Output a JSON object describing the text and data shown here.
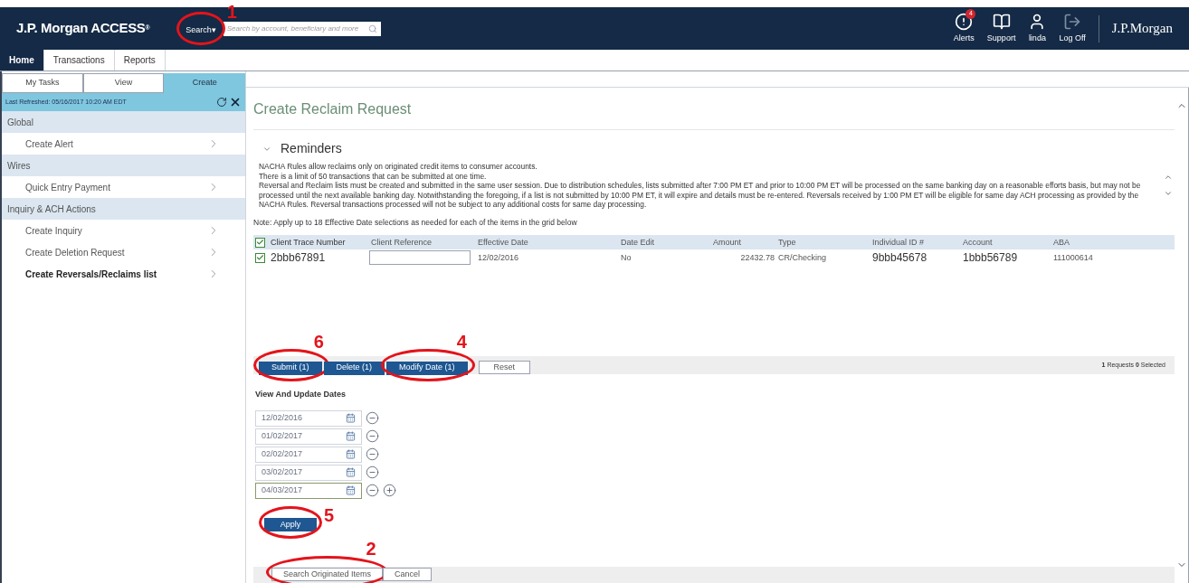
{
  "header": {
    "brand": "J.P. Morgan ACCESS",
    "brand_mark": "®",
    "search_button": {
      "label": "Search▾",
      "callout": "1"
    },
    "search_field": {
      "placeholder": "Search by account, beneficiary and more"
    },
    "actions": [
      {
        "kind": "alert",
        "label": "Alerts",
        "badge": "4"
      },
      {
        "kind": "support",
        "label": "Support"
      },
      {
        "kind": "user",
        "label": "linda"
      },
      {
        "kind": "logoff",
        "label": "Log Off"
      }
    ],
    "logo": "J.P.Morgan"
  },
  "tabs": [
    {
      "label": "Home",
      "selected": true
    },
    {
      "label": "Transactions",
      "selected": false
    },
    {
      "label": "Reports",
      "selected": false
    }
  ],
  "sidebar": {
    "tabs": [
      {
        "label": "My Tasks",
        "selected": false
      },
      {
        "label": "View",
        "selected": false
      },
      {
        "label": "Create",
        "selected": true
      }
    ],
    "last_refreshed": "Last Refreshed: 05/16/2017 10:20 AM EDT",
    "items": [
      {
        "kind": "group",
        "label": "Global"
      },
      {
        "kind": "link",
        "label": "Create Alert",
        "active": false
      },
      {
        "kind": "group",
        "label": "Wires"
      },
      {
        "kind": "link",
        "label": "Quick Entry Payment",
        "active": false
      },
      {
        "kind": "group",
        "label": "Inquiry & ACH Actions"
      },
      {
        "kind": "link",
        "label": "Create Inquiry",
        "active": false
      },
      {
        "kind": "link",
        "label": "Create Deletion Request",
        "active": false
      },
      {
        "kind": "link",
        "label": "Create Reversals/Reclaims list",
        "active": true
      }
    ]
  },
  "main": {
    "title": "Create Reclaim Request",
    "reminders": {
      "title": "Reminders",
      "expanded": true,
      "lines": [
        "NACHA Rules allow reclaims only on originated credit items to consumer accounts.",
        "There is a limit of 50 transactions that can be submitted at one time.",
        "Reversal and Reclaim lists must be created and submitted in the same user session. Due to distribution schedules, lists submitted after 7:00 PM ET and prior to 10:00 PM ET will be processed on the same banking day on a reasonable efforts basis, but may not be processed until the next available banking day. Notwithstanding the foregoing, if a list is not submitted by 10:00 PM ET, it will expire and details must be re-entered. Reversals received by 1:00 PM ET will be eligible for same day ACH processing as provided by the NACHA Rules. Reversal transactions processed will not be subject to any additional costs for same day processing."
      ]
    },
    "note": "Note: Apply up to 18 Effective Date selections as needed for each of the items in the grid below",
    "table": {
      "all_checked": true,
      "columns": [
        "Client Trace Number",
        "Client Reference",
        "Effective Date",
        "Date Edit",
        "Amount",
        "Type",
        "Individual ID #",
        "Account",
        "ABA"
      ],
      "rows": [
        {
          "checked": true,
          "cells": [
            "2bbb67891",
            "",
            "12/02/2016",
            "No",
            "22432.78",
            "CR/Checking",
            "9bbb45678",
            "1bbb56789",
            "111000614"
          ]
        }
      ]
    },
    "actions": [
      {
        "kind": "primary",
        "label": "Submit (1)",
        "callout": "6"
      },
      {
        "kind": "primary",
        "label": "Delete (1)"
      },
      {
        "kind": "primary",
        "label": "Modify Date (1)",
        "callout": "4"
      },
      {
        "kind": "secondary",
        "label": "Reset"
      }
    ],
    "summary": "**1** Requests  **0** Selected",
    "dates": {
      "title": "View And Update Dates",
      "fields": [
        {
          "value": "12/02/2016",
          "focused": false,
          "addable": false
        },
        {
          "value": "01/02/2017",
          "focused": false,
          "addable": false
        },
        {
          "value": "02/02/2017",
          "focused": false,
          "addable": false
        },
        {
          "value": "03/02/2017",
          "focused": false,
          "addable": false
        },
        {
          "value": "04/03/2017",
          "focused": true,
          "addable": true
        }
      ],
      "apply": {
        "label": "Apply",
        "callout": "5"
      }
    },
    "footer": [
      {
        "label": "Search Originated Items",
        "callout": "2"
      },
      {
        "label": "Cancel"
      }
    ]
  }
}
